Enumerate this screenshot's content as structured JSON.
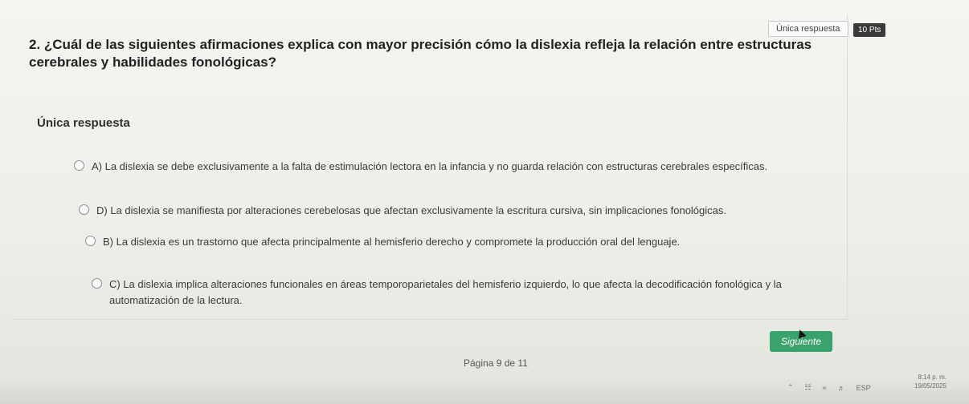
{
  "header": {
    "answer_type_tag": "Única respuesta",
    "points_tag": "10 Pts"
  },
  "question": {
    "text": "2. ¿Cuál de las siguientes afirmaciones explica con mayor precisión cómo la dislexia refleja la relación entre estructuras cerebrales y habilidades fonológicas?",
    "answer_type_label": "Única respuesta"
  },
  "options": [
    {
      "text": "A) La dislexia se debe exclusivamente a la falta de estimulación lectora en la infancia y no guarda relación con estructuras cerebrales específicas."
    },
    {
      "text": "D) La dislexia se manifiesta por alteraciones cerebelosas que afectan exclusivamente la escritura cursiva, sin implicaciones fonológicas."
    },
    {
      "text": "B) La dislexia es un trastorno que afecta principalmente al hemisferio derecho y compromete la producción oral del lenguaje."
    },
    {
      "text": "C) La dislexia implica alteraciones funcionales en áreas temporoparietales del hemisferio izquierdo, lo que afecta la decodificación fonológica y la automatización de la lectura."
    }
  ],
  "footer": {
    "next_label": "Siguiente",
    "page_indicator": "Página 9 de 11"
  },
  "taskbar": {
    "language": "ESP",
    "time": "8:14 p. m.",
    "date": "19/05/2025"
  },
  "colors": {
    "next_button": "#3aa36b",
    "points_tag": "#3a3a3a"
  }
}
